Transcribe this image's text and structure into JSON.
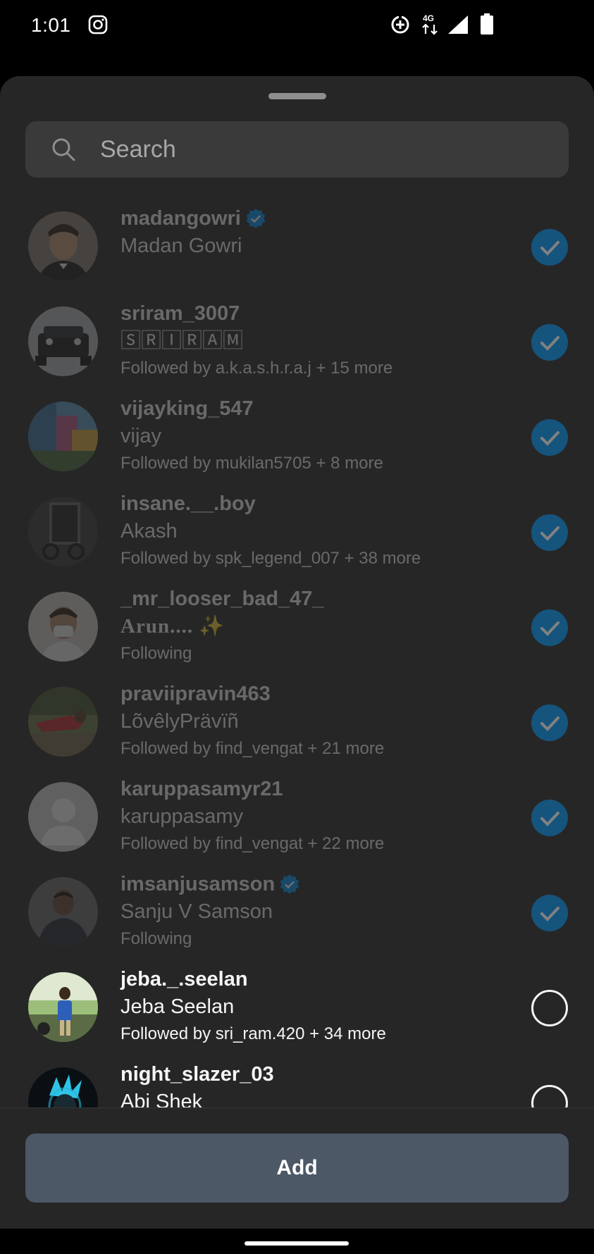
{
  "status_bar": {
    "time": "1:01",
    "network": "4G",
    "icons": [
      "instagram-icon",
      "data-saver-icon",
      "network-4g-icon",
      "signal-icon",
      "battery-icon"
    ]
  },
  "search": {
    "placeholder": "Search"
  },
  "users": [
    {
      "username": "madangowri",
      "verified": true,
      "full_name": "Madan Gowri",
      "subtitle": "",
      "selected": true,
      "dimmed": true
    },
    {
      "username": "sriram_3007",
      "verified": false,
      "full_name": "🅂🅁🄸🅁🄰🄼",
      "subtitle": "Followed by a.k.a.s.h.r.a.j + 15 more",
      "selected": true,
      "dimmed": true
    },
    {
      "username": "vijayking_547",
      "verified": false,
      "full_name": "vijay",
      "subtitle": "Followed by mukilan5705 + 8 more",
      "selected": true,
      "dimmed": true
    },
    {
      "username": "insane.__.boy",
      "verified": false,
      "full_name": "Akash",
      "subtitle": "Followed by spk_legend_007 + 38 more",
      "selected": true,
      "dimmed": true
    },
    {
      "username": "_mr_looser_bad_47_",
      "verified": false,
      "full_name": "Arun.... ✨",
      "subtitle": "Following",
      "selected": true,
      "dimmed": true
    },
    {
      "username": "praviipravin463",
      "verified": false,
      "full_name": "LõvêlyPrävïñ",
      "subtitle": "Followed by find_vengat + 21 more",
      "selected": true,
      "dimmed": true
    },
    {
      "username": "karuppasamyr21",
      "verified": false,
      "full_name": "karuppasamy",
      "subtitle": "Followed by find_vengat + 22 more",
      "selected": true,
      "dimmed": true
    },
    {
      "username": "imsanjusamson",
      "verified": true,
      "full_name": "Sanju V Samson",
      "subtitle": "Following",
      "selected": true,
      "dimmed": true
    },
    {
      "username": "jeba._.seelan",
      "verified": false,
      "full_name": "Jeba Seelan",
      "subtitle": "Followed by sri_ram.420 + 34 more",
      "selected": false,
      "dimmed": false
    },
    {
      "username": "night_slazer_03",
      "verified": false,
      "full_name": "Abi Shek",
      "subtitle": "",
      "selected": false,
      "dimmed": false
    }
  ],
  "actions": {
    "add_label": "Add"
  },
  "colors": {
    "accent": "#0095f6",
    "sheet_bg": "#262626",
    "button_bg": "#4d5866"
  }
}
